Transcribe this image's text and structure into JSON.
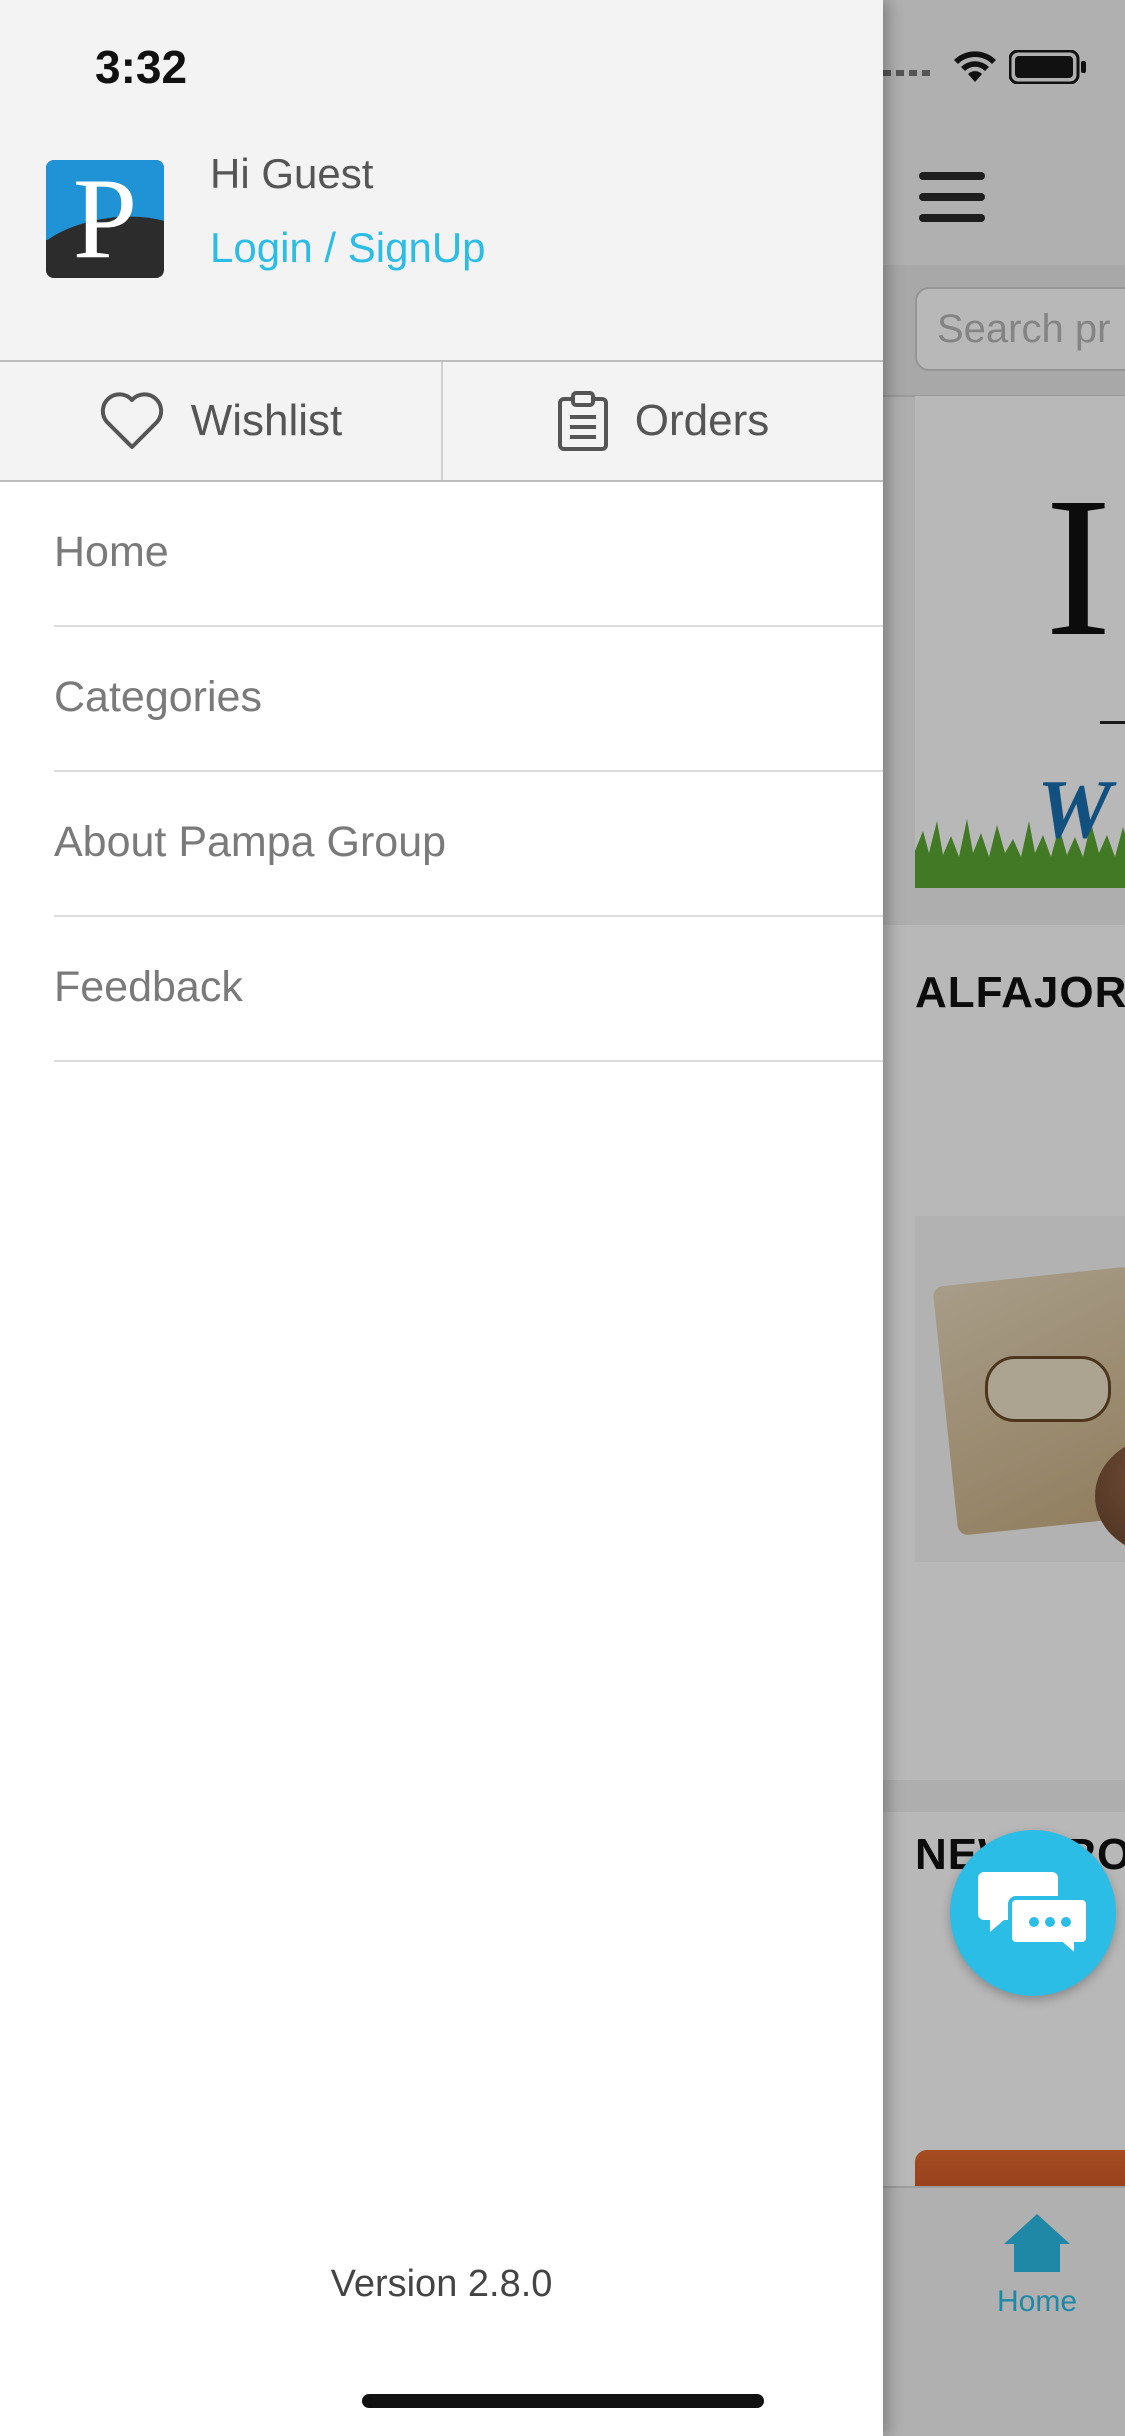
{
  "status_bar": {
    "time": "3:32"
  },
  "drawer": {
    "greeting": "Hi Guest",
    "login_link": "Login / SignUp",
    "logo_letter": "P",
    "tabs": [
      {
        "label": "Wishlist",
        "icon": "heart-icon"
      },
      {
        "label": "Orders",
        "icon": "clipboard-icon"
      }
    ],
    "menu": [
      {
        "label": "Home"
      },
      {
        "label": "Categories"
      },
      {
        "label": "About Pampa Group"
      },
      {
        "label": "Feedback"
      }
    ],
    "version": "Version 2.8.0"
  },
  "main": {
    "search_placeholder": "Search pr",
    "banner_letter": "I",
    "banner_script": "W",
    "section_1_title": "ALFAJOR",
    "section_2_title": "NEW PRO",
    "tabbar": {
      "home_label": "Home"
    }
  },
  "colors": {
    "accent": "#2bbde6",
    "logo_blue": "#1f93d6"
  }
}
